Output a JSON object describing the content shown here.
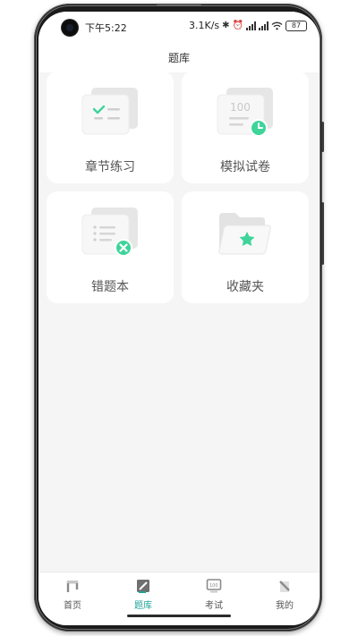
{
  "status_bar": {
    "time": "下午5:22",
    "net_speed": "3.1K/s",
    "battery": "87"
  },
  "header": {
    "title": "题库"
  },
  "cards": [
    {
      "label": "章节练习",
      "icon": "checklist-icon"
    },
    {
      "label": "模拟试卷",
      "icon": "exam-paper-clock-icon"
    },
    {
      "label": "错题本",
      "icon": "wrong-list-icon"
    },
    {
      "label": "收藏夹",
      "icon": "favorite-folder-icon"
    }
  ],
  "tabs": [
    {
      "label": "首页",
      "icon": "home-icon",
      "active": false
    },
    {
      "label": "题库",
      "icon": "question-bank-icon",
      "active": true
    },
    {
      "label": "考试",
      "icon": "exam-icon",
      "active": false
    },
    {
      "label": "我的",
      "icon": "profile-icon",
      "active": false
    }
  ],
  "colors": {
    "accent": "#3ed49a",
    "active_tab": "#1fa398",
    "background": "#f5f5f5"
  }
}
